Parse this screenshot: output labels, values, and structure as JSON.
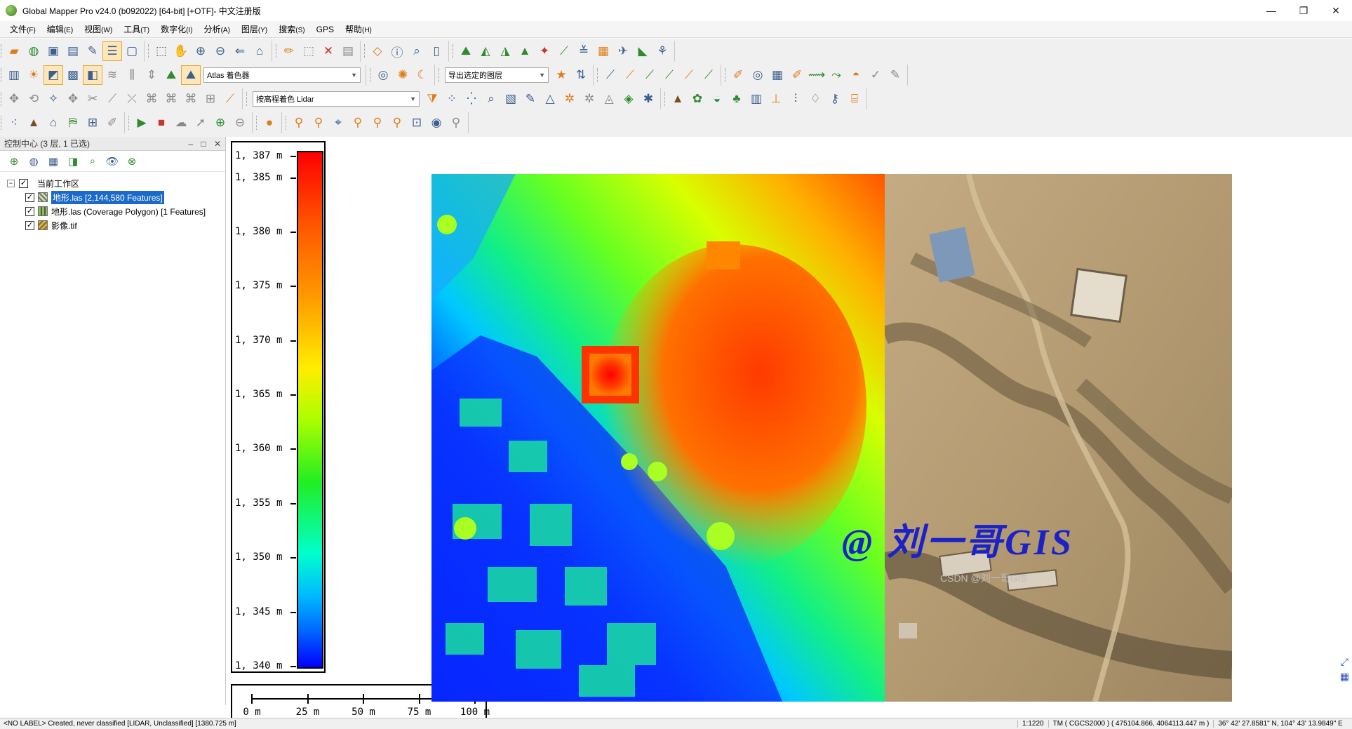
{
  "window": {
    "title": "Global Mapper Pro v24.0 (b092022) [64-bit] [+OTF]- 中文注册版",
    "minimize": "—",
    "restore": "❐",
    "close": "✕"
  },
  "menu": [
    {
      "label": "文件",
      "accel": "(F)"
    },
    {
      "label": "编辑",
      "accel": "(E)"
    },
    {
      "label": "视图",
      "accel": "(W)"
    },
    {
      "label": "工具",
      "accel": "(T)"
    },
    {
      "label": "数字化",
      "accel": "(I)"
    },
    {
      "label": "分析",
      "accel": "(A)"
    },
    {
      "label": "图层",
      "accel": "(Y)"
    },
    {
      "label": "搜索",
      "accel": "(S)"
    },
    {
      "label": "GPS",
      "accel": ""
    },
    {
      "label": "帮助",
      "accel": "(H)"
    }
  ],
  "toolbar": {
    "shader_select": "Atlas 着色器",
    "export_select": "导出选定的图层",
    "lidar_color_select": "按高程着色 Lidar"
  },
  "control_center": {
    "title": "控制中心 (3 层, 1 已选)",
    "ctrls": [
      "–",
      "□",
      "✕"
    ],
    "workspace": "当前工作区",
    "layers": [
      {
        "label": "地形.las [2,144,580 Features]",
        "icon": "las",
        "selected": true
      },
      {
        "label": "地形.las (Coverage Polygon) [1 Features]",
        "icon": "poly",
        "selected": false
      },
      {
        "label": "影像.tif",
        "icon": "tif",
        "selected": false
      }
    ]
  },
  "legend": {
    "unit": "m",
    "ticks": [
      "1,387 m",
      "1,385 m",
      "1,380 m",
      "1,375 m",
      "1,370 m",
      "1,365 m",
      "1,360 m",
      "1,355 m",
      "1,350 m",
      "1,345 m",
      "1,340 m"
    ],
    "tick_values": [
      1387,
      1385,
      1380,
      1375,
      1370,
      1365,
      1360,
      1355,
      1350,
      1345,
      1340
    ]
  },
  "scalebar": {
    "labels": [
      "0 m",
      "25 m",
      "50 m",
      "75 m",
      "100 m"
    ]
  },
  "watermark": "@ 刘一哥GIS",
  "csdn_mark": "CSDN @刘一哥GIS",
  "statusbar": {
    "left": "<NO LABEL> Created, never classified [LIDAR, Unclassified] [1380.725 m]",
    "scale": "1:1220",
    "projection": "TM ( CGCS2000 ) ( 475104.866, 4064113.447 m )",
    "latlon": "36° 42' 27.8581\" N, 104° 43' 13.9849\" E"
  },
  "colors": {
    "selection": "#1b6ac9",
    "watermark": "#1a22c8"
  }
}
